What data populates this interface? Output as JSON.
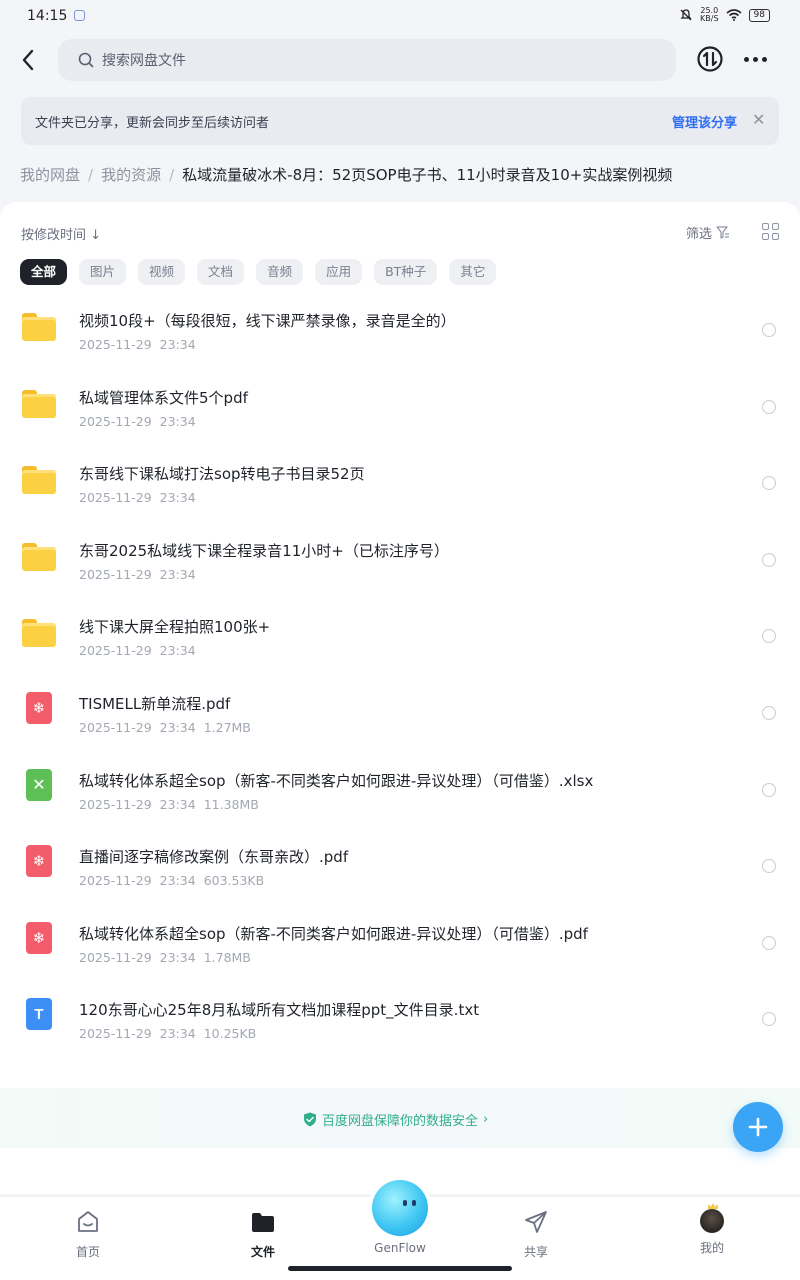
{
  "status_bar": {
    "time": "14:15",
    "net_speed_value": "25.0",
    "net_speed_unit": "KB/S",
    "battery": "98"
  },
  "search": {
    "placeholder": "搜索网盘文件"
  },
  "share_banner": {
    "text": "文件夹已分享，更新会同步至后续访问者",
    "manage_label": "管理该分享",
    "close_glyph": "✕"
  },
  "breadcrumb": {
    "items": [
      "我的网盘",
      "我的资源"
    ],
    "separator": "/",
    "current": "私域流量破冰术-8月：52页SOP电子书、11小时录音及10+实战案例视频"
  },
  "toolbar": {
    "sort_label": "按修改时间 ↓",
    "filter_label": "筛选"
  },
  "chips": [
    {
      "label": "全部",
      "active": true
    },
    {
      "label": "图片",
      "active": false
    },
    {
      "label": "视频",
      "active": false
    },
    {
      "label": "文档",
      "active": false
    },
    {
      "label": "音频",
      "active": false
    },
    {
      "label": "应用",
      "active": false
    },
    {
      "label": "BT种子",
      "active": false
    },
    {
      "label": "其它",
      "active": false
    }
  ],
  "files": [
    {
      "type": "folder",
      "name": "视频10段+（每段很短，线下课严禁录像，录音是全的）",
      "date": "2025-11-29",
      "time": "23:34",
      "size": ""
    },
    {
      "type": "folder",
      "name": "私域管理体系文件5个pdf",
      "date": "2025-11-29",
      "time": "23:34",
      "size": ""
    },
    {
      "type": "folder",
      "name": "东哥线下课私域打法sop转电子书目录52页",
      "date": "2025-11-29",
      "time": "23:34",
      "size": ""
    },
    {
      "type": "folder",
      "name": "东哥2025私域线下课全程录音11小时+（已标注序号）",
      "date": "2025-11-29",
      "time": "23:34",
      "size": ""
    },
    {
      "type": "folder",
      "name": "线下课大屏全程拍照100张+",
      "date": "2025-11-29",
      "time": "23:34",
      "size": ""
    },
    {
      "type": "pdf",
      "name": "TISMELL新单流程.pdf",
      "date": "2025-11-29",
      "time": "23:34",
      "size": "1.27MB"
    },
    {
      "type": "xlsx",
      "name": "私域转化体系超全sop（新客-不同类客户如何跟进-异议处理）（可借鉴）.xlsx",
      "date": "2025-11-29",
      "time": "23:34",
      "size": "11.38MB"
    },
    {
      "type": "pdf",
      "name": "直播间逐字稿修改案例（东哥亲改）.pdf",
      "date": "2025-11-29",
      "time": "23:34",
      "size": "603.53KB"
    },
    {
      "type": "pdf",
      "name": "私域转化体系超全sop（新客-不同类客户如何跟进-异议处理）（可借鉴）.pdf",
      "date": "2025-11-29",
      "time": "23:34",
      "size": "1.78MB"
    },
    {
      "type": "txt",
      "name": "120东哥心心25年8月私域所有文档加课程ppt_文件目录.txt",
      "date": "2025-11-29",
      "time": "23:34",
      "size": "10.25KB"
    }
  ],
  "safety": {
    "text": "百度网盘保障你的数据安全",
    "chevron": "›"
  },
  "bottom_nav": [
    {
      "label": "首页",
      "icon": "home-icon",
      "active": false
    },
    {
      "label": "文件",
      "icon": "folder-icon",
      "active": true
    },
    {
      "label": "GenFlow",
      "icon": "genflow-icon",
      "active": false
    },
    {
      "label": "共享",
      "icon": "send-icon",
      "active": false
    },
    {
      "label": "我的",
      "icon": "avatar",
      "active": false
    }
  ],
  "colors": {
    "accent": "#2f6ff2",
    "fab": "#3aa4f5",
    "folder": "#fcd043",
    "pdf": "#f25c6b",
    "xlsx": "#5fbf57",
    "txt": "#3d8ef5",
    "safety": "#2fae8e"
  }
}
